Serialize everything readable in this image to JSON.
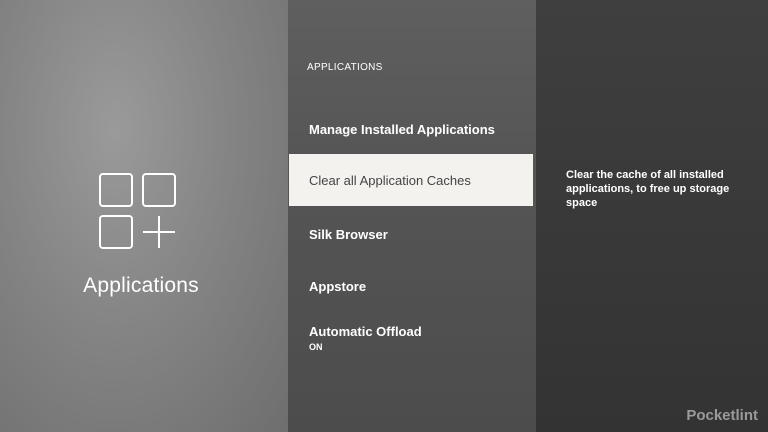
{
  "category": {
    "title": "Applications",
    "icon": "apps-grid-plus-icon"
  },
  "menu": {
    "heading": "APPLICATIONS",
    "items": [
      {
        "label": "Manage Installed Applications",
        "value": ""
      },
      {
        "label": "Clear all Application Caches",
        "value": ""
      },
      {
        "label": "Silk Browser",
        "value": ""
      },
      {
        "label": "Appstore",
        "value": ""
      },
      {
        "label": "Automatic Offload",
        "value": "ON"
      }
    ],
    "selected_index": 1
  },
  "description": {
    "text": "Clear the cache of all installed applications, to free up storage space"
  },
  "watermark": {
    "text": "Pocketlint"
  },
  "colors": {
    "selected_bg": "#f3f2ef",
    "selected_text": "#444444",
    "text": "#ffffff"
  }
}
